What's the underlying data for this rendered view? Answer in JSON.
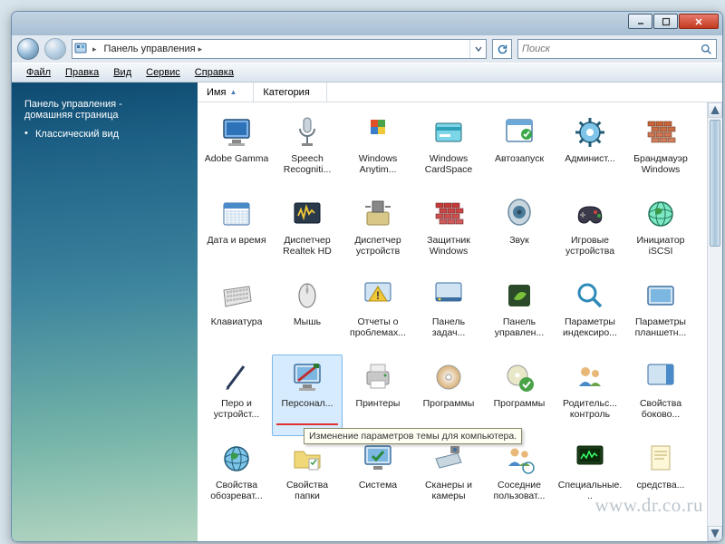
{
  "titlebar": {
    "min": "",
    "max": "",
    "close": ""
  },
  "nav": {
    "addr_icon": "control-panel-icon",
    "addr_seg1": "Панель управления",
    "addr_sep": "▸",
    "search_placeholder": "Поиск"
  },
  "menubar": {
    "file": "Файл",
    "edit": "Правка",
    "view": "Вид",
    "service": "Сервис",
    "help": "Справка"
  },
  "sidebar": {
    "header_line1": "Панель управления -",
    "header_line2": "домашняя страница",
    "items": [
      {
        "label": "Классический вид"
      }
    ]
  },
  "columns": {
    "name": "Имя",
    "category": "Категория"
  },
  "tooltip": "Изменение параметров темы для компьютера.",
  "watermark": "www.dr.co.ru",
  "icons": [
    {
      "name": "adobe-gamma",
      "label": "Adobe Gamma",
      "hue": 210,
      "shape": "monitor"
    },
    {
      "name": "speech-recognition",
      "label": "Speech Recogniti...",
      "hue": 200,
      "shape": "mic"
    },
    {
      "name": "windows-anytime",
      "label": "Windows Anytim...",
      "hue": 35,
      "shape": "flag"
    },
    {
      "name": "windows-cardspace",
      "label": "Windows CardSpace",
      "hue": 190,
      "shape": "card"
    },
    {
      "name": "autorun",
      "label": "Автозапуск",
      "hue": 160,
      "shape": "window"
    },
    {
      "name": "admin-tools",
      "label": "Админист...",
      "hue": 200,
      "shape": "gear"
    },
    {
      "name": "firewall",
      "label": "Брандмауэр Windows",
      "hue": 18,
      "shape": "wall"
    },
    {
      "name": "date-time",
      "label": "Дата и время",
      "hue": 210,
      "shape": "calendar"
    },
    {
      "name": "realtek",
      "label": "Диспетчер Realtek HD",
      "hue": 40,
      "shape": "sound-card"
    },
    {
      "name": "device-manager",
      "label": "Диспетчер устройств",
      "hue": 45,
      "shape": "device"
    },
    {
      "name": "defender",
      "label": "Защитник Windows",
      "hue": 0,
      "shape": "wall"
    },
    {
      "name": "sound",
      "label": "Звук",
      "hue": 195,
      "shape": "speaker"
    },
    {
      "name": "game-controllers",
      "label": "Игровые устройства",
      "hue": 270,
      "shape": "gamepad"
    },
    {
      "name": "iscsi",
      "label": "Инициатор iSCSI",
      "hue": 160,
      "shape": "globe"
    },
    {
      "name": "keyboard",
      "label": "Клавиатура",
      "hue": 0,
      "shape": "keyboard"
    },
    {
      "name": "mouse",
      "label": "Мышь",
      "hue": 0,
      "shape": "mouse"
    },
    {
      "name": "problem-reports",
      "label": "Отчеты о проблемах...",
      "hue": 45,
      "shape": "warning"
    },
    {
      "name": "taskbar",
      "label": "Панель задач...",
      "hue": 205,
      "shape": "taskbar"
    },
    {
      "name": "nvidia-panel",
      "label": "Панель управлен...",
      "hue": 100,
      "shape": "nvidia"
    },
    {
      "name": "index-options",
      "label": "Параметры индексиро...",
      "hue": 200,
      "shape": "search"
    },
    {
      "name": "tablet-settings",
      "label": "Параметры планшетн...",
      "hue": 200,
      "shape": "tablet"
    },
    {
      "name": "pen-input",
      "label": "Перо и устройст...",
      "hue": 220,
      "shape": "pen"
    },
    {
      "name": "personalization",
      "label": "Персонал...",
      "hue": 200,
      "shape": "monitor-paint",
      "selected": true,
      "redline": true
    },
    {
      "name": "printers",
      "label": "Принтеры",
      "hue": 45,
      "shape": "printer"
    },
    {
      "name": "programs-features",
      "label": "Программы",
      "hue": 35,
      "shape": "disc"
    },
    {
      "name": "default-programs",
      "label": "Программы",
      "hue": 95,
      "shape": "disc-check"
    },
    {
      "name": "parental",
      "label": "Родительс... контроль",
      "hue": 35,
      "shape": "people"
    },
    {
      "name": "sidebar-props",
      "label": "Свойства боково...",
      "hue": 195,
      "shape": "sidebar"
    },
    {
      "name": "browser-props",
      "label": "Свойства обозреват...",
      "hue": 200,
      "shape": "globe"
    },
    {
      "name": "folder-options",
      "label": "Свойства папки",
      "hue": 48,
      "shape": "folder"
    },
    {
      "name": "system",
      "label": "Система",
      "hue": 200,
      "shape": "monitor-check"
    },
    {
      "name": "scanners",
      "label": "Сканеры и камеры",
      "hue": 210,
      "shape": "scanner"
    },
    {
      "name": "network",
      "label": "Соседние пользоват...",
      "hue": 195,
      "shape": "people-net"
    },
    {
      "name": "admin",
      "label": "Специальные...",
      "hue": 100,
      "shape": "monitor-green"
    },
    {
      "name": "sync",
      "label": "средства...",
      "hue": 50,
      "shape": "doc"
    }
  ]
}
